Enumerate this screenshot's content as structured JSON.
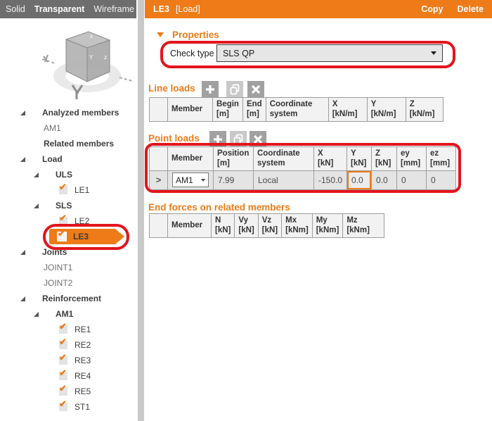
{
  "colors": {
    "accent_orange": "#ee7b17",
    "annotation_red": "#e3151d",
    "toolbar_gray": "#6e6e6e",
    "table_header_bg": "#f2f2f2",
    "table_row_bg": "#e4e4e4",
    "table_border": "#9c9c9c"
  },
  "toolbar": {
    "items": [
      "Solid",
      "Transparent",
      "Wireframe"
    ],
    "active_item": "Transparent"
  },
  "header": {
    "title": "LE3",
    "tag": "[Load]",
    "actions": [
      "Copy",
      "Delete"
    ]
  },
  "tree": {
    "items": [
      {
        "label": "Analyzed members",
        "type": "group",
        "level": 1,
        "expander": true
      },
      {
        "label": "AM1",
        "type": "plain",
        "level": 1
      },
      {
        "label": "Related members",
        "type": "group",
        "level": 1,
        "expander": false
      },
      {
        "label": "Load",
        "type": "group",
        "level": 1,
        "expander": true
      },
      {
        "label": "ULS",
        "type": "group",
        "level": 2,
        "expander": true
      },
      {
        "label": "LE1",
        "type": "check",
        "level": 3,
        "checked": true
      },
      {
        "label": "SLS",
        "type": "group",
        "level": 2,
        "expander": true
      },
      {
        "label": "LE2",
        "type": "check",
        "level": 3,
        "checked": true
      },
      {
        "label": "LE3",
        "type": "check",
        "level": 3,
        "checked": true,
        "selected": true
      },
      {
        "label": "Joints",
        "type": "group",
        "level": 1,
        "expander": true
      },
      {
        "label": "JOINT1",
        "type": "plain",
        "level": 1
      },
      {
        "label": "JOINT2",
        "type": "plain",
        "level": 1
      },
      {
        "label": "Reinforcement",
        "type": "group",
        "level": 1,
        "expander": true
      },
      {
        "label": "AM1",
        "type": "group",
        "level": 2,
        "expander": true
      },
      {
        "label": "RE1",
        "type": "check",
        "level": 3,
        "checked": true
      },
      {
        "label": "RE2",
        "type": "check",
        "level": 3,
        "checked": true
      },
      {
        "label": "RE3",
        "type": "check",
        "level": 3,
        "checked": true
      },
      {
        "label": "RE4",
        "type": "check",
        "level": 3,
        "checked": true
      },
      {
        "label": "RE5",
        "type": "check",
        "level": 3,
        "checked": true
      },
      {
        "label": "ST1",
        "type": "check",
        "level": 3,
        "checked": true
      }
    ]
  },
  "properties": {
    "title": "Properties",
    "check_type_label": "Check type",
    "check_type_value": "SLS QP"
  },
  "line_loads": {
    "title": "Line loads",
    "columns": [
      {
        "line1": "",
        "line2": ""
      },
      {
        "line1": "Member",
        "line2": ""
      },
      {
        "line1": "Begin",
        "line2": "[m]"
      },
      {
        "line1": "End",
        "line2": "[m]"
      },
      {
        "line1": "Coordinate",
        "line2": "system"
      },
      {
        "line1": "X",
        "line2": "[kN/m]"
      },
      {
        "line1": "Y",
        "line2": "[kN/m]"
      },
      {
        "line1": "Z",
        "line2": "[kN/m]"
      }
    ],
    "rows": []
  },
  "point_loads": {
    "title": "Point loads",
    "columns": [
      {
        "line1": "",
        "line2": ""
      },
      {
        "line1": "Member",
        "line2": ""
      },
      {
        "line1": "Position",
        "line2": "[m]"
      },
      {
        "line1": "Coordinate",
        "line2": "system"
      },
      {
        "line1": "X",
        "line2": "[kN]"
      },
      {
        "line1": "Y",
        "line2": "[kN]"
      },
      {
        "line1": "Z",
        "line2": "[kN]"
      },
      {
        "line1": "ey",
        "line2": "[mm]"
      },
      {
        "line1": "ez",
        "line2": "[mm]"
      }
    ],
    "row": {
      "member": "AM1",
      "position": "7.99",
      "coordinate_system": "Local",
      "x": "-150.0",
      "y": "0.0",
      "z": "0.0",
      "ey": "0",
      "ez": "0",
      "selected_field": "y"
    }
  },
  "end_forces": {
    "title": "End forces on related members",
    "columns": [
      {
        "line1": "",
        "line2": ""
      },
      {
        "line1": "Member",
        "line2": ""
      },
      {
        "line1": "N",
        "line2": "[kN]"
      },
      {
        "line1": "Vy",
        "line2": "[kN]"
      },
      {
        "line1": "Vz",
        "line2": "[kN]"
      },
      {
        "line1": "Mx",
        "line2": "[kNm]"
      },
      {
        "line1": "My",
        "line2": "[kNm]"
      },
      {
        "line1": "Mz",
        "line2": "[kNm]"
      }
    ]
  }
}
